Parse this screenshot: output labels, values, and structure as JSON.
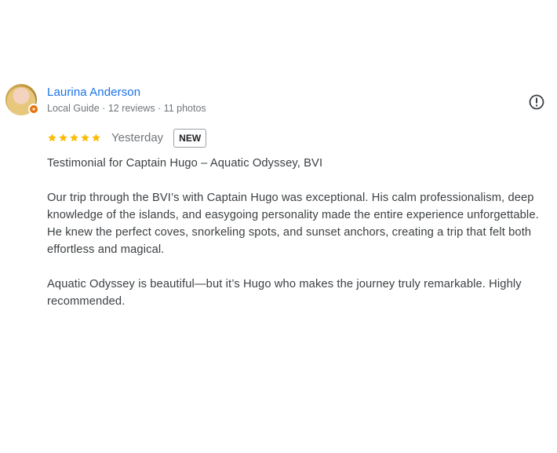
{
  "reviewer": {
    "name": "Laurina Anderson",
    "meta": "Local Guide · 12 reviews · 11 photos",
    "avatar_icon": "profile-photo",
    "badge_icon": "local-guide-badge"
  },
  "rating": {
    "stars": 5,
    "max": 5,
    "star_color": "#fbbc04"
  },
  "time": "Yesterday",
  "badge": "NEW",
  "report_icon": "report-icon",
  "text": {
    "title": "Testimonial for Captain Hugo – Aquatic Odyssey, BVI",
    "paragraph1": "Our trip through the BVI’s with Captain Hugo was exceptional. His calm professionalism, deep knowledge of the islands, and easygoing personality made the entire experience unforgettable. He knew the perfect coves, snorkeling spots, and sunset anchors, creating a trip that felt both effortless and magical.",
    "paragraph2": "Aquatic Odyssey is beautiful—but it’s Hugo who makes the journey truly remarkable. Highly recommended."
  },
  "colors": {
    "name": "#1a73e8",
    "meta": "#70757a",
    "badge_orange": "#e8710a"
  }
}
